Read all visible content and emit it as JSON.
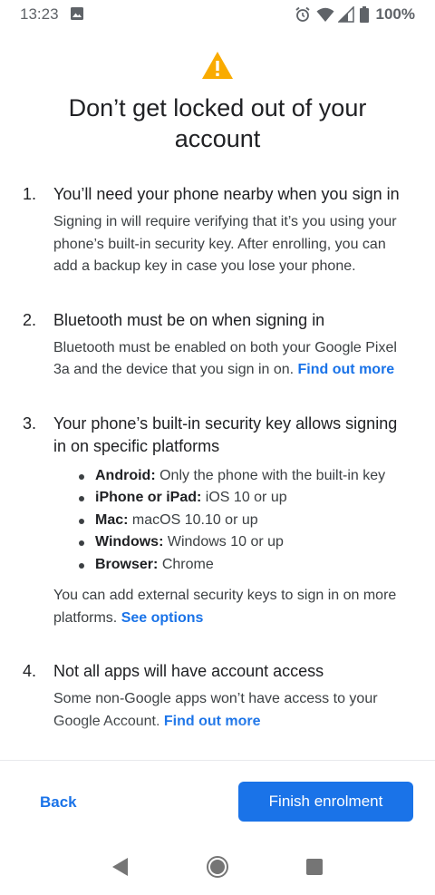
{
  "status_bar": {
    "time": "13:23",
    "battery": "100%",
    "icons": [
      "image-icon",
      "alarm-icon",
      "wifi-icon",
      "signal-icon",
      "battery-icon"
    ]
  },
  "header": {
    "title": "Don’t get locked out of your account",
    "icon": "warning-icon",
    "icon_color": "#f9ab00"
  },
  "steps": [
    {
      "number": "1.",
      "heading": "You’ll need your phone nearby when you sign in",
      "body": "Signing in will require verifying that it’s you using your phone’s built-in security key. After enrolling, you can add a backup key in case you lose your phone."
    },
    {
      "number": "2.",
      "heading": "Bluetooth must be on when signing in",
      "body": "Bluetooth must be enabled on both your Google Pixel 3a and the device that you sign in on.",
      "link": "Find out more"
    },
    {
      "number": "3.",
      "heading": "Your phone’s built-in security key allows signing in on specific platforms",
      "bullets": [
        {
          "label": "Android:",
          "text": "Only the phone with the built-in key"
        },
        {
          "label": "iPhone or iPad:",
          "text": "iOS 10 or up"
        },
        {
          "label": "Mac:",
          "text": "macOS 10.10 or up"
        },
        {
          "label": "Windows:",
          "text": "Windows 10 or up"
        },
        {
          "label": "Browser:",
          "text": "Chrome"
        }
      ],
      "body": "You can add external security keys to sign in on more platforms.",
      "link": "See options"
    },
    {
      "number": "4.",
      "heading": "Not all apps will have account access",
      "body": "Some non-Google apps won’t have access to your Google Account.",
      "link": "Find out more"
    }
  ],
  "actions": {
    "back_label": "Back",
    "finish_label": "Finish enrolment",
    "primary_color": "#1a73e8"
  },
  "nav": {
    "icons": [
      "back-triangle-icon",
      "home-circle-icon",
      "recents-square-icon"
    ]
  }
}
